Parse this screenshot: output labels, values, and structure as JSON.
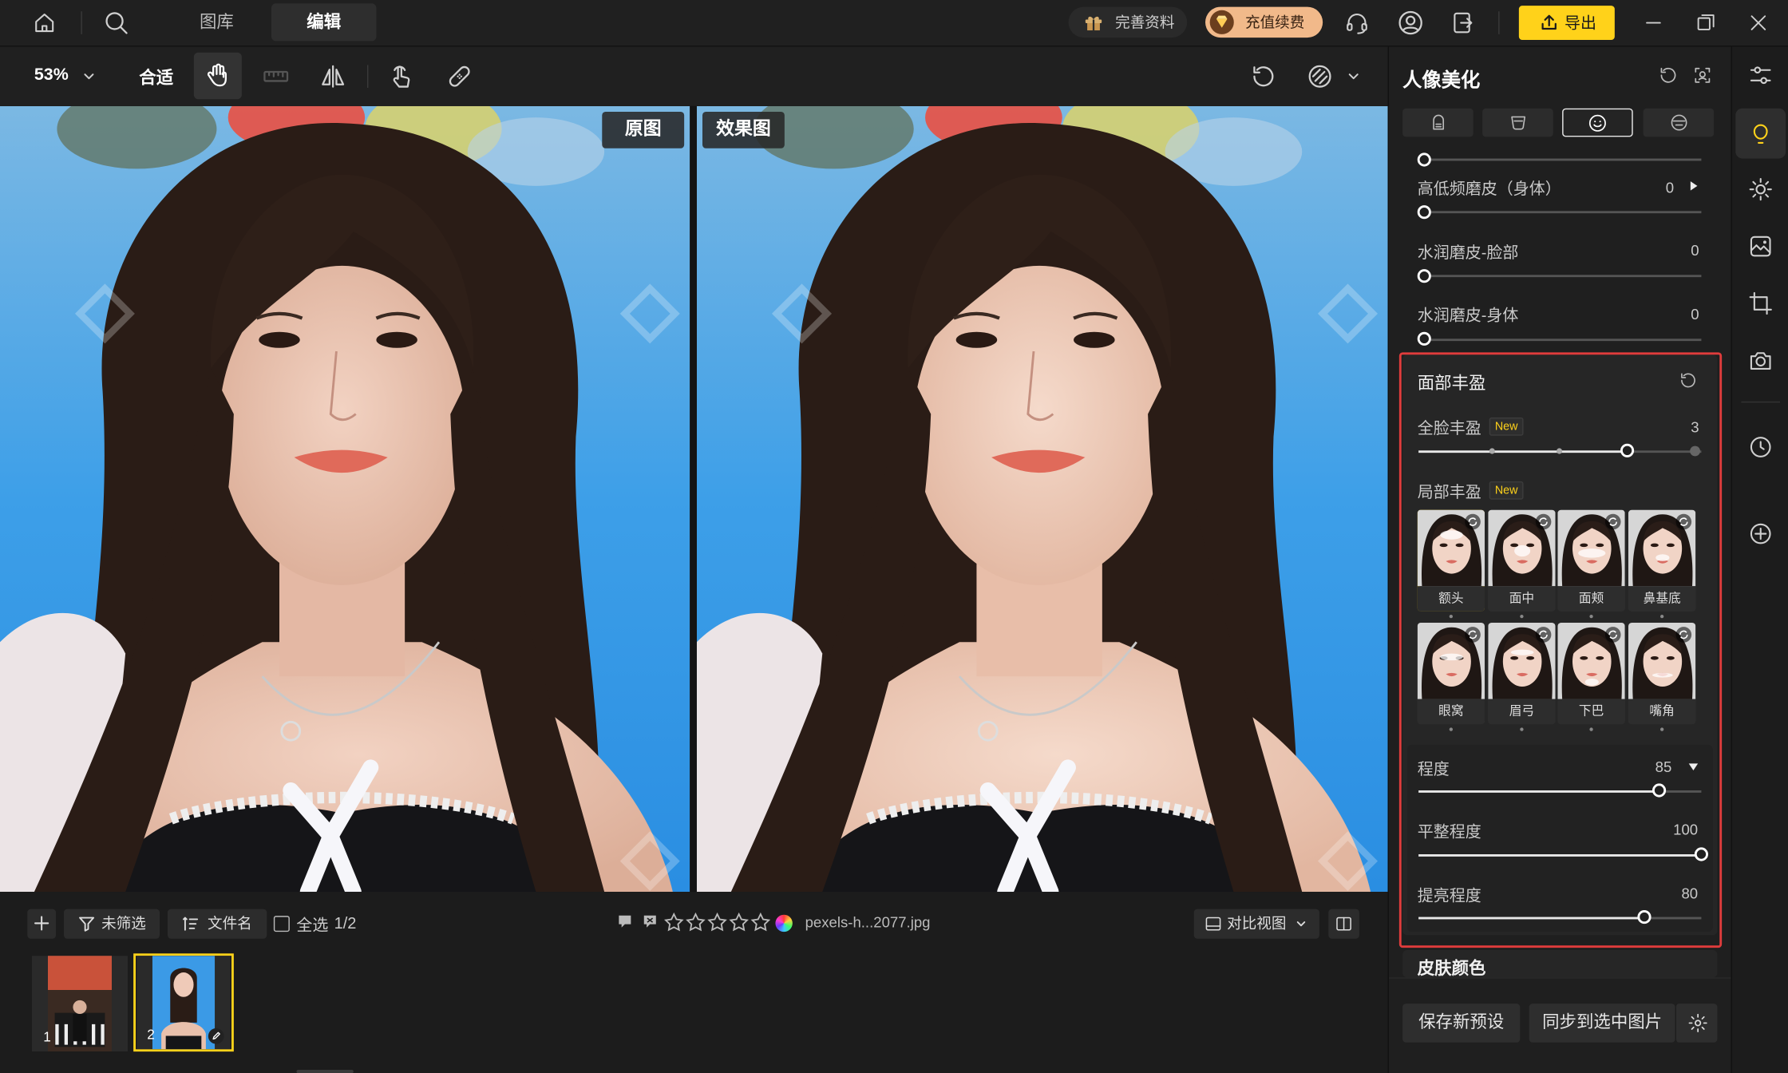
{
  "topbar": {
    "tabs": [
      {
        "label": "图库"
      },
      {
        "label": "编辑"
      }
    ],
    "complete_profile": "完善资料",
    "recharge": "充值续费",
    "export": "导出"
  },
  "toolbar": {
    "zoom": "53%",
    "fit": "合适"
  },
  "canvas": {
    "original_label": "原图",
    "effect_label": "效果图"
  },
  "bottombar": {
    "filter": "未筛选",
    "sort": "文件名",
    "select_all": "全选",
    "selection_count": "1/2",
    "filename": "pexels-h...2077.jpg",
    "compare_view": "对比视图",
    "thumbnails": [
      {
        "index": "1"
      },
      {
        "index": "2"
      }
    ]
  },
  "panel": {
    "title": "人像美化",
    "smoothing": [
      {
        "label": "高低频磨皮（身体）",
        "value": "0"
      },
      {
        "label": "水润磨皮-脸部",
        "value": "0"
      },
      {
        "label": "水润磨皮-身体",
        "value": "0"
      }
    ],
    "face_fill": {
      "title": "面部丰盈",
      "full_face": {
        "label": "全脸丰盈",
        "badge": "New",
        "value": "3"
      },
      "local": {
        "label": "局部丰盈",
        "badge": "New"
      },
      "regions": [
        {
          "label": "额头",
          "selected": true
        },
        {
          "label": "面中"
        },
        {
          "label": "面颊"
        },
        {
          "label": "鼻基底"
        },
        {
          "label": "眼窝"
        },
        {
          "label": "眉弓"
        },
        {
          "label": "下巴"
        },
        {
          "label": "嘴角"
        }
      ],
      "degree": {
        "label": "程度",
        "value": "85",
        "level": 0.85
      },
      "flatness": {
        "label": "平整程度",
        "value": "100",
        "level": 1.0
      },
      "brighten": {
        "label": "提亮程度",
        "value": "80",
        "level": 0.8
      }
    },
    "skin_color_title": "皮肤颜色",
    "save_preset": "保存新预设",
    "sync_selected": "同步到选中图片"
  },
  "colors": {
    "accent_yellow": "#ffd21a",
    "highlight_red": "#e03c3c",
    "recharge_bg": "#f1b98a"
  }
}
